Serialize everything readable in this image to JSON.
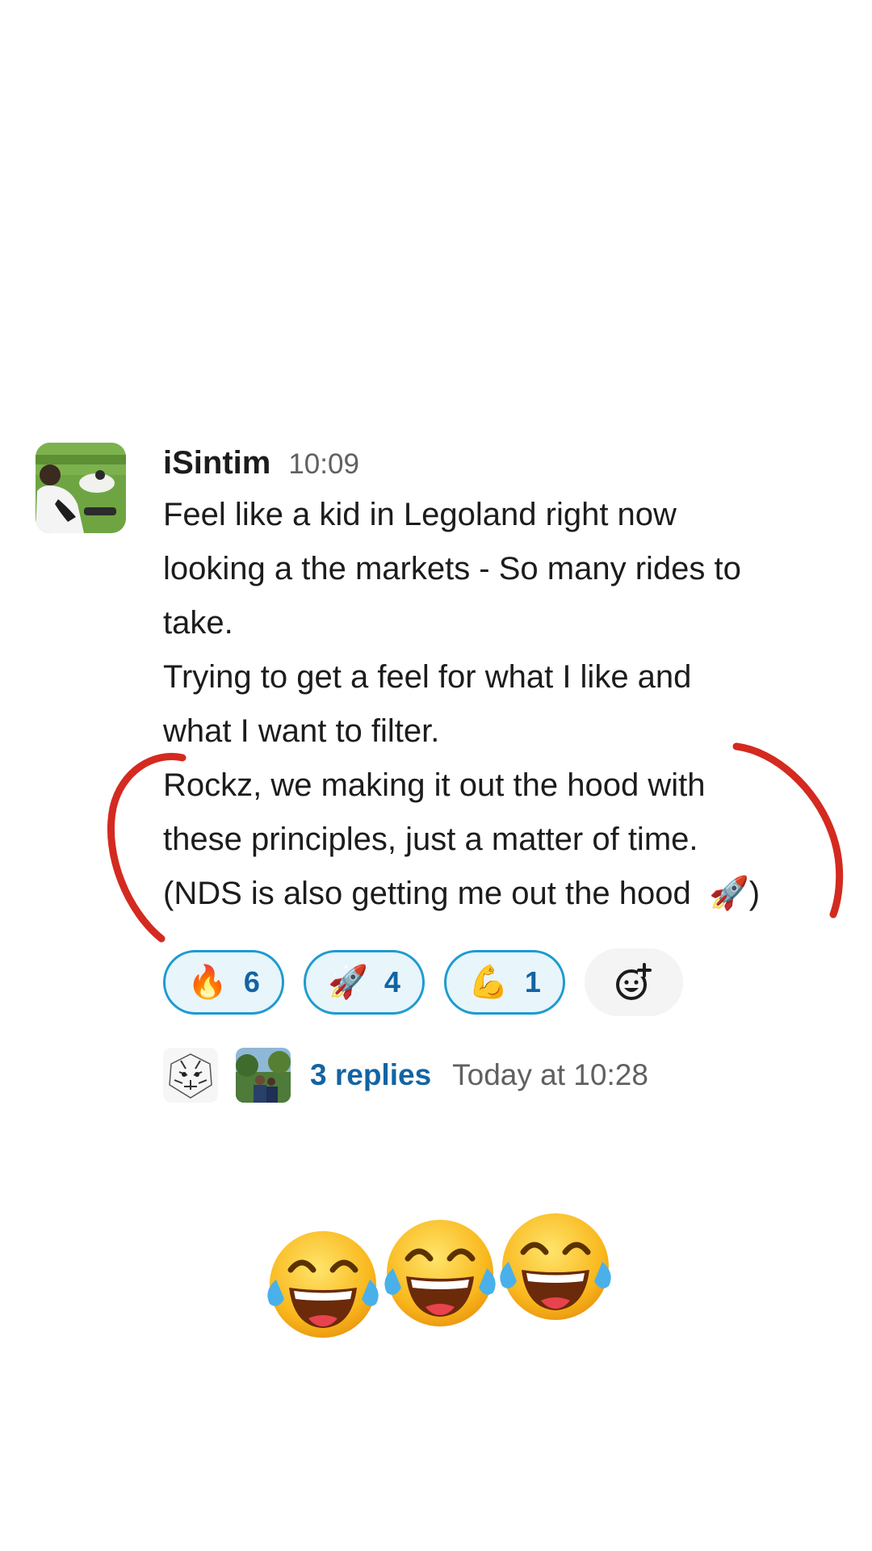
{
  "message": {
    "username": "iSintim",
    "time": "10:09",
    "lines": [
      "Feel like a kid in Legoland right now",
      "looking a the markets - So many rides to",
      "take.",
      "Trying to get a feel for what I like and",
      "what I want to filter.",
      "Rockz, we making it out the hood with",
      "these principles, just a matter of time.",
      "(NDS is also getting me out the hood"
    ],
    "last_line_suffix": ")",
    "last_line_emoji": "🚀"
  },
  "reactions": [
    {
      "emoji": "🔥",
      "icon": "fire-icon",
      "count": "6"
    },
    {
      "emoji": "🚀",
      "icon": "rocket-icon",
      "count": "4"
    },
    {
      "emoji": "💪",
      "icon": "flexed-biceps-icon",
      "count": "1"
    }
  ],
  "add_reaction_icon": "add-emoji-icon",
  "thread": {
    "replies_label": "3 replies",
    "last_reply": "Today at 10:28"
  },
  "decorations": {
    "laugh_emoji_count": 3,
    "laugh_icon": "face-with-tears-of-joy-icon",
    "annotation_color": "#d42a20"
  },
  "colors": {
    "link": "#1264a3",
    "reaction_border": "#1d9bd1",
    "reaction_bg": "#e8f5fa",
    "muted_text": "#616061"
  }
}
